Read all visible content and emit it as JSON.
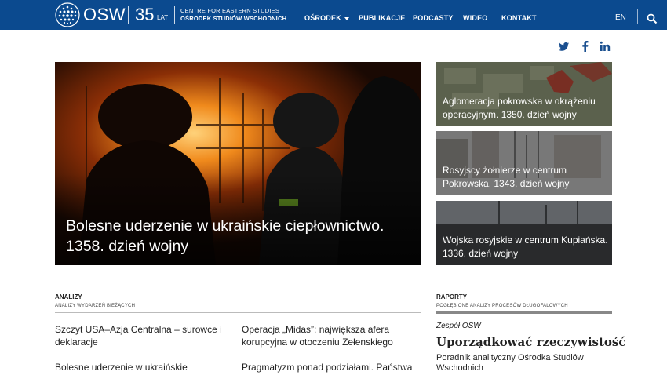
{
  "header": {
    "logo_text": "OSW",
    "years": "35",
    "years_suffix": "LAT",
    "org_name_en": "CENTRE FOR EASTERN STUDIES",
    "org_name_pl": "OŚRODEK STUDIÓW WSCHODNICH",
    "nav": [
      {
        "label": "OŚRODEK",
        "dropdown": true
      },
      {
        "label": "PUBLIKACJE"
      },
      {
        "label": "PODCASTY"
      },
      {
        "label": "WIDEO"
      },
      {
        "label": "KONTAKT"
      }
    ],
    "language": "EN",
    "search_icon": "search-icon",
    "bar_color": "#0b4a8f"
  },
  "social": [
    "twitter-icon",
    "facebook-icon",
    "linkedin-icon"
  ],
  "hero": {
    "title_line1": "Bolesne uderzenie w ukraińskie ciepłownictwo.",
    "title_line2": "1358. dzień wojny"
  },
  "side_cards": [
    {
      "caption": "Aglomeracja pokrowska w okrążeniu operacyjnym. 1350. dzień wojny"
    },
    {
      "caption": "Rosyjscy żołnierze w centrum Pokrowska. 1343. dzień wojny"
    },
    {
      "caption": "Wojska rosyjskie w centrum Kupiańska. 1336. dzień wojny"
    }
  ],
  "analyses": {
    "title": "ANALIZY",
    "subtitle": "ANALIZY WYDARZEŃ BIEŻĄCYCH",
    "items": [
      "Szczyt USA–Azja Centralna – surowce i deklaracje",
      "Operacja „Midas”: największa afera korupcyjna w otoczeniu Zełenskiego",
      "Bolesne uderzenie w ukraińskie",
      "Pragmatyzm ponad podziałami. Państwa"
    ]
  },
  "reports": {
    "title": "RAPORTY",
    "subtitle": "POGŁĘBIONE ANALIZY PROCESÓW DŁUGOFALOWYCH",
    "author": "Zespół OSW",
    "report_title": "Uporządkować rzeczywistość",
    "description": "Poradnik analityczny Ośrodka Studiów Wschodnich"
  }
}
